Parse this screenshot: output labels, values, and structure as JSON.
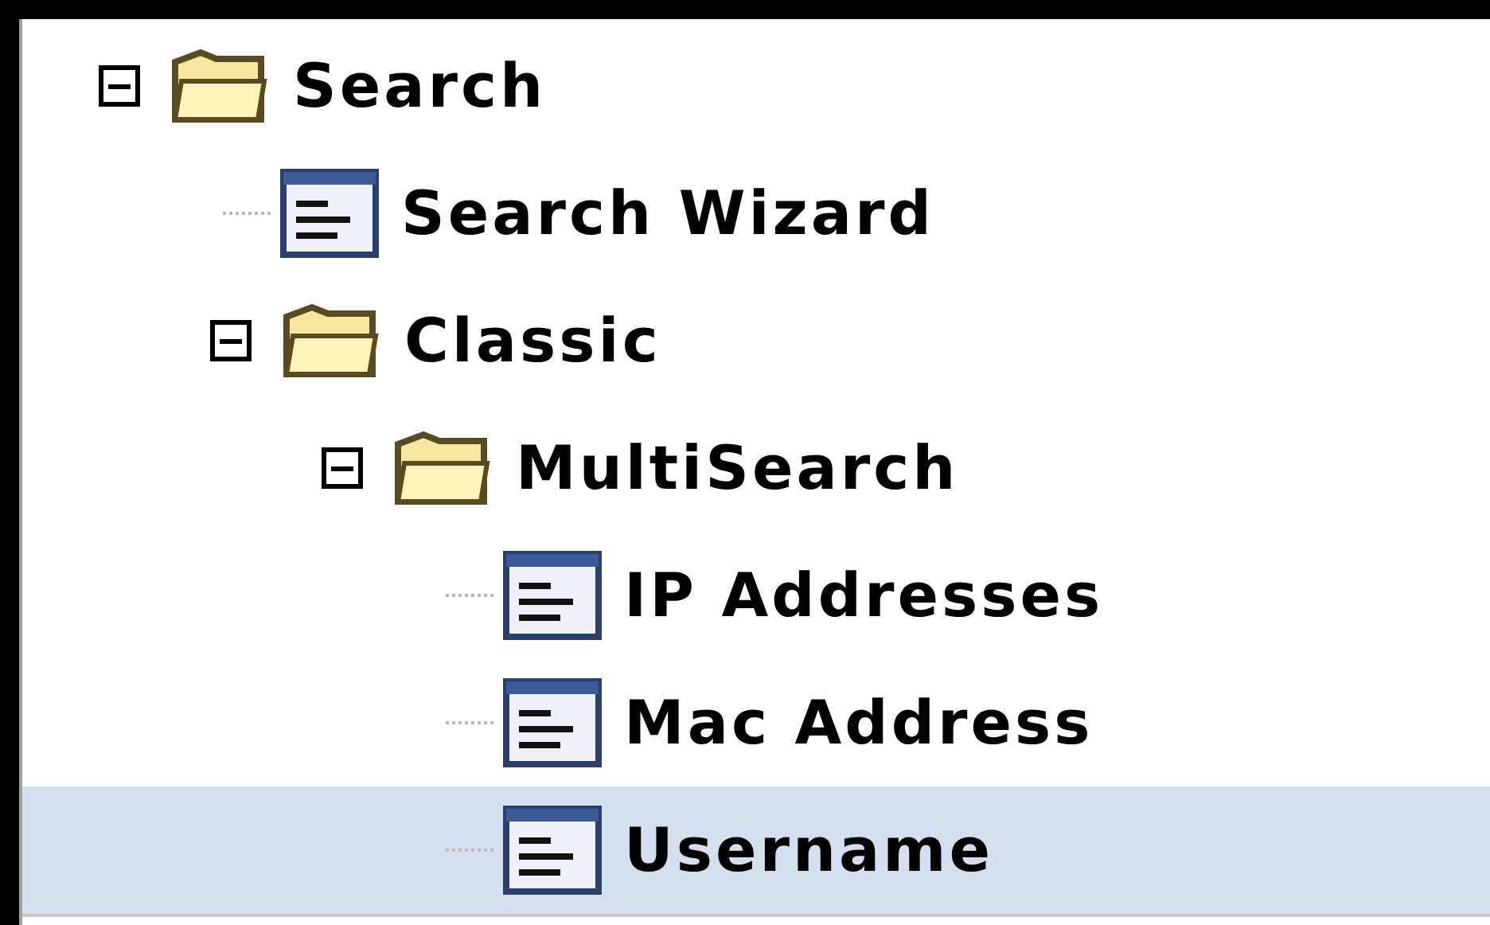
{
  "tree": [
    {
      "label": "Search",
      "kind": "folder",
      "expanded": true,
      "selected": false,
      "children": [
        {
          "label": "Search Wizard",
          "kind": "document",
          "selected": false
        },
        {
          "label": "Classic",
          "kind": "folder",
          "expanded": true,
          "selected": false,
          "children": [
            {
              "label": "MultiSearch",
              "kind": "folder",
              "expanded": true,
              "selected": false,
              "children": [
                {
                  "label": "IP Addresses",
                  "kind": "document",
                  "selected": false
                },
                {
                  "label": "Mac Address",
                  "kind": "document",
                  "selected": false
                },
                {
                  "label": "Username",
                  "kind": "document",
                  "selected": true
                }
              ]
            }
          ]
        }
      ]
    }
  ]
}
